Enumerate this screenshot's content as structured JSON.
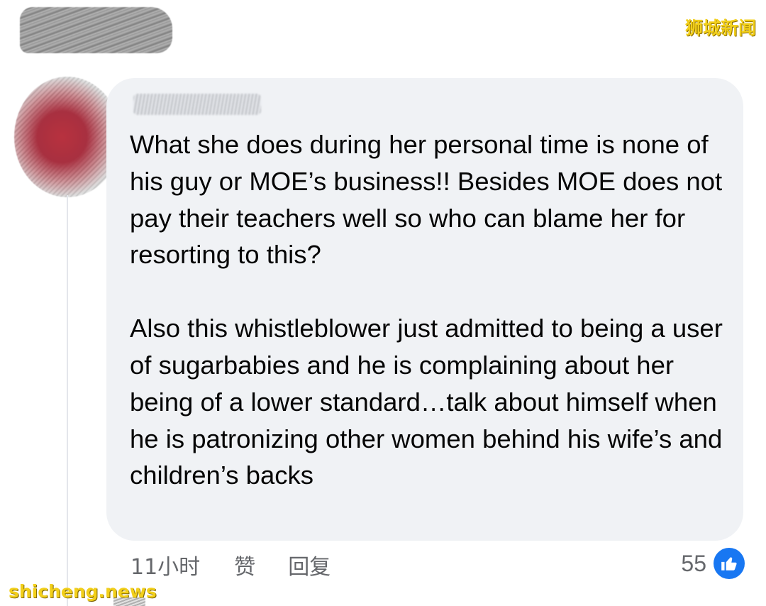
{
  "watermarks": {
    "top": "狮城新闻",
    "bottom": "shicheng.news"
  },
  "comment": {
    "paragraphs": [
      "What she does during her personal time is none of his guy or MOE’s business!! Besides MOE does not pay their teachers well so who can blame her for resorting to this?",
      "Also this whistleblower just admitted to being a user of sugarbabies and he is complaining about her being of a lower standard…talk about himself when he is patronizing other women behind his wife’s and children’s backs"
    ],
    "time": "11小时",
    "like_label": "赞",
    "reply_label": "回复",
    "reaction_count": "55"
  },
  "colors": {
    "bubble": "#f0f2f5",
    "meta_text": "#65676b",
    "like_blue": "#1877f2",
    "watermark": "#f2cf1a"
  },
  "icons": {
    "reaction": "thumbs-up-icon"
  }
}
